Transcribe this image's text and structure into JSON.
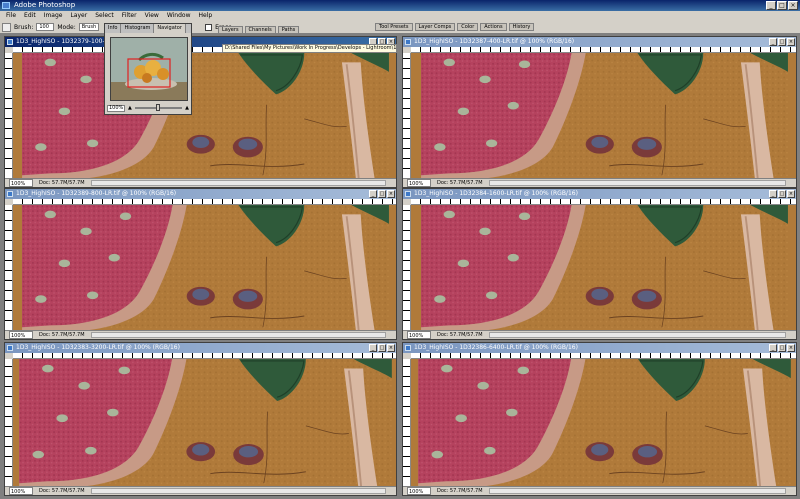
{
  "app": {
    "title": "Adobe Photoshop",
    "window_buttons": [
      "_",
      "□",
      "×"
    ]
  },
  "menu": [
    "File",
    "Edit",
    "Image",
    "Layer",
    "Select",
    "Filter",
    "View",
    "Window",
    "Help"
  ],
  "options_bar": {
    "brush_label": "Brush:",
    "brush_size": "100",
    "mode_label": "Mode:",
    "mode_value": "Brush",
    "erase_label": "Erase"
  },
  "panel_wells": [
    "Tool Presets",
    "Layer Comps",
    "Color",
    "Actions",
    "History"
  ],
  "layer_tabs": [
    "Layers",
    "Channels",
    "Paths"
  ],
  "navigator": {
    "tabs": [
      "Info",
      "Histogram",
      "Navigator"
    ],
    "active_tab": "Navigator",
    "zoom": "100%"
  },
  "documents": [
    {
      "title": "1D3_HighISO - 1D32379-100-LR.tif @ 100% (RGB/16)",
      "full_title": "D:\\Shared Files\\My Pictures\\Work In Progress\\Develops - Lightroom\\1D3_HighISO - 1D32379-100-LR.tif @ 100% (RGB/16)",
      "zoom": "100%",
      "doc_info": "Doc: 57.7M/57.7M",
      "active": true
    },
    {
      "title": "1D3_HighISO - 1D32387-400-LR.tif @ 100% (RGB/16)",
      "zoom": "100%",
      "doc_info": "Doc: 57.7M/57.7M",
      "active": false
    },
    {
      "title": "1D3_HighISO - 1D32389-800-LR.tif @ 100% (RGB/16)",
      "zoom": "100%",
      "doc_info": "Doc: 57.7M/57.7M",
      "active": false
    },
    {
      "title": "1D3_HighISO - 1D32384-1600-LR.tif @ 100% (RGB/16)",
      "zoom": "100%",
      "doc_info": "Doc: 57.7M/57.7M",
      "active": false
    },
    {
      "title": "1D3_HighISO - 1D32383-3200-LR.tif @ 100% (RGB/16)",
      "zoom": "100%",
      "doc_info": "Doc: 57.7M/57.7M",
      "active": false
    },
    {
      "title": "1D3_HighISO - 1D32386-6400-LR.tif @ 100% (RGB/16)",
      "zoom": "100%",
      "doc_info": "Doc: 57.7M/57.7M",
      "active": false
    }
  ],
  "doc_buttons": [
    "_",
    "□",
    "×"
  ]
}
